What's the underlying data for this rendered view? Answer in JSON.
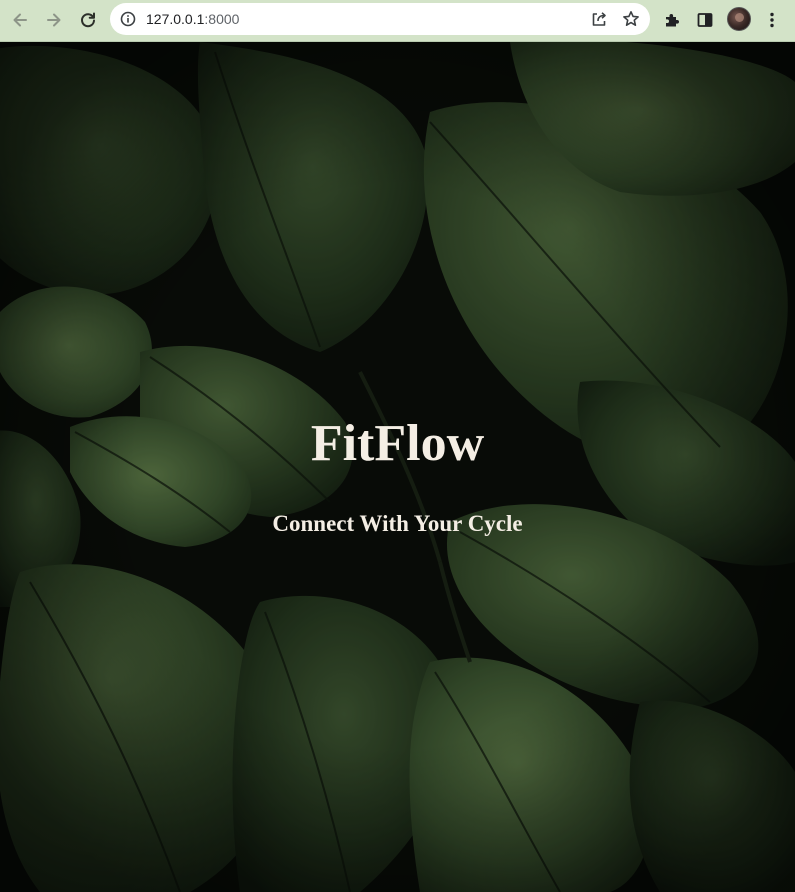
{
  "browser": {
    "url_host": "127.0.0.1",
    "url_port": ":8000",
    "icons": {
      "back": "arrow-left-icon",
      "forward": "arrow-right-icon",
      "reload": "reload-icon",
      "site_info": "info-icon",
      "share": "share-icon",
      "bookmark": "star-icon",
      "extensions": "puzzle-icon",
      "side_panel": "side-panel-icon",
      "menu": "kebab-menu-icon"
    },
    "colors": {
      "toolbar": "#d3e3c8",
      "omnibox": "#ffffff"
    }
  },
  "hero": {
    "title": "FitFlow",
    "subtitle": "Connect With Your Cycle",
    "background_image": "dark green leaves with water droplets",
    "text_color": "#f4eee4"
  }
}
